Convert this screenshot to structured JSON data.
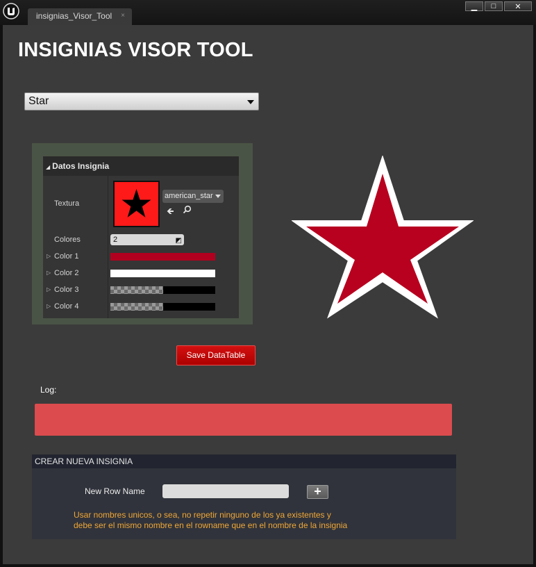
{
  "window": {
    "tab_title": "insignias_Visor_Tool",
    "tab_close": "×",
    "minimize": "▁",
    "maximize": "□",
    "close": "✕"
  },
  "app": {
    "title": "INSIGNIAS VISOR TOOL"
  },
  "insignia_select": {
    "selected": "Star"
  },
  "details": {
    "header": "Datos Insignia",
    "textura_label": "Textura",
    "texture_asset": "american_star",
    "colores_label": "Colores",
    "colores_value": "2",
    "colors": [
      {
        "label": "Color 1",
        "color": "#b1001f"
      },
      {
        "label": "Color 2",
        "color": "#ffffff"
      },
      {
        "label": "Color 3",
        "color": "transparent-black"
      },
      {
        "label": "Color 4",
        "color": "transparent-black"
      }
    ]
  },
  "preview": {
    "fill": "#b8001f",
    "outline": "#ffffff",
    "icon": "star-icon"
  },
  "save_button": "Save DataTable",
  "log": {
    "label": "Log:",
    "value": "",
    "color": "#dc4b4e"
  },
  "create": {
    "header": "CREAR NUEVA INSIGNIA",
    "row_name_label": "New Row Name",
    "row_name_value": "",
    "add_button": "+",
    "hint_line1": "Usar nombres unicos, o sea, no repetir ninguno de los ya existentes y",
    "hint_line2": "debe ser el mismo nombre en el rowname que en el nombre de la insignia"
  },
  "colors": {
    "save_red": "#c00000",
    "hint_orange": "#f0a737"
  }
}
